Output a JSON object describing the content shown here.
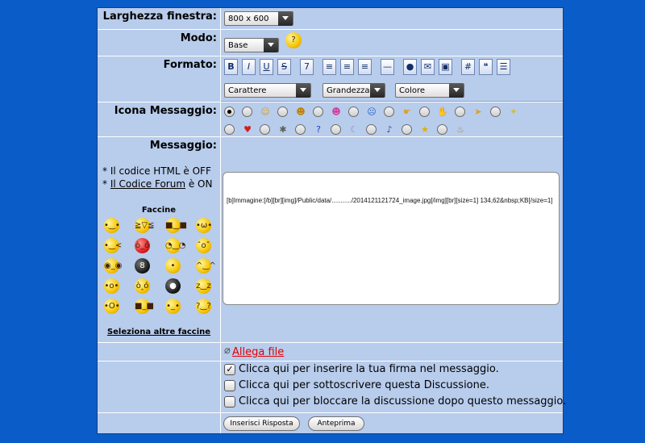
{
  "labels": {
    "window_width": "Larghezza finestra:",
    "mode": "Modo:",
    "format": "Formato:",
    "message_icon": "Icona Messaggio:",
    "message": "Messaggio:"
  },
  "selects": {
    "window_width": "800 x 600",
    "mode": "Base",
    "font": "Carattere",
    "size": "Grandezza",
    "color": "Colore"
  },
  "toolbar": {
    "buttons": [
      {
        "name": "bold",
        "glyph": "B"
      },
      {
        "name": "italic",
        "glyph": "I"
      },
      {
        "name": "underline",
        "glyph": "U"
      },
      {
        "name": "strikethrough",
        "glyph": "S"
      },
      {
        "name": "page",
        "glyph": "7"
      },
      {
        "name": "align-left",
        "glyph": "≡"
      },
      {
        "name": "align-center",
        "glyph": "≡"
      },
      {
        "name": "align-right",
        "glyph": "≡"
      },
      {
        "name": "horizontal-rule",
        "glyph": "—"
      },
      {
        "name": "hyperlink",
        "glyph": "●"
      },
      {
        "name": "email",
        "glyph": "✉"
      },
      {
        "name": "image",
        "glyph": "▣"
      },
      {
        "name": "code",
        "glyph": "#"
      },
      {
        "name": "quote",
        "glyph": "❝"
      },
      {
        "name": "list",
        "glyph": "☰"
      }
    ]
  },
  "icons_row1": [
    {
      "name": "none",
      "glyph": "",
      "color": "#000000"
    },
    {
      "name": "smile",
      "glyph": "☺",
      "color": "#e0a000"
    },
    {
      "name": "grin",
      "glyph": "☻",
      "color": "#c08000"
    },
    {
      "name": "surprised",
      "glyph": "☻",
      "color": "#d040a0"
    },
    {
      "name": "sad",
      "glyph": "☹",
      "color": "#2060c0"
    },
    {
      "name": "hand-point",
      "glyph": "☛",
      "color": "#e0a020"
    },
    {
      "name": "thumb",
      "glyph": "✋",
      "color": "#e0a020"
    },
    {
      "name": "arrow",
      "glyph": "➤",
      "color": "#e0a020"
    },
    {
      "name": "lightbulb",
      "glyph": "✦",
      "color": "#e0c000"
    }
  ],
  "icons_row2": [
    {
      "name": "heart",
      "glyph": "♥",
      "color": "#d02020"
    },
    {
      "name": "bug",
      "glyph": "✱",
      "color": "#606060"
    },
    {
      "name": "question",
      "glyph": "?",
      "color": "#2040c0"
    },
    {
      "name": "moon",
      "glyph": "☾",
      "color": "#9090c0"
    },
    {
      "name": "music",
      "glyph": "♪",
      "color": "#4040a0"
    },
    {
      "name": "star",
      "glyph": "★",
      "color": "#e0b000"
    },
    {
      "name": "cake",
      "glyph": "♨",
      "color": "#c08040"
    }
  ],
  "html_status": {
    "prefix": "* Il codice HTML è ",
    "value": "OFF"
  },
  "forum_status": {
    "prefix": "* ",
    "link": "Il Codice Forum",
    "middle": " è ",
    "value": "ON"
  },
  "emoticons": {
    "title": "Faccine",
    "more_link": "Seleziona altre faccine",
    "faces": [
      "•‿•",
      "≧▽≦",
      "■‿■",
      "•ω•",
      "•‿<",
      "ò_ó",
      "◔‿◔",
      "ˆoˆ",
      "◉_◉",
      "8",
      "•︵•",
      "^‿^",
      "•o•",
      "ò‸ó",
      "●",
      "z‿z",
      "•O•",
      "■_■",
      "•_•",
      "?‿?"
    ]
  },
  "message_text": "[b]Immagine:[/b][br][img]/Public/data/.........../2014121121724_image.jpg[/img][br][size=1] 134,62&nbsp;KB[/size=1]",
  "attach": {
    "label": " Allega file"
  },
  "options": [
    {
      "label": "Clicca qui per inserire la tua firma nel messaggio.",
      "checked": true
    },
    {
      "label": "Clicca qui per sottoscrivere questa Discussione.",
      "checked": false
    },
    {
      "label": "Clicca qui per bloccare la discussione dopo questo messaggio.",
      "checked": false
    }
  ],
  "buttons": {
    "submit": "Inserisci Risposta",
    "preview": "Anteprima"
  },
  "colors": {
    "page_bg": "#0a5cc8",
    "cell_bg": "#b8ccec",
    "link": "#e00000"
  }
}
